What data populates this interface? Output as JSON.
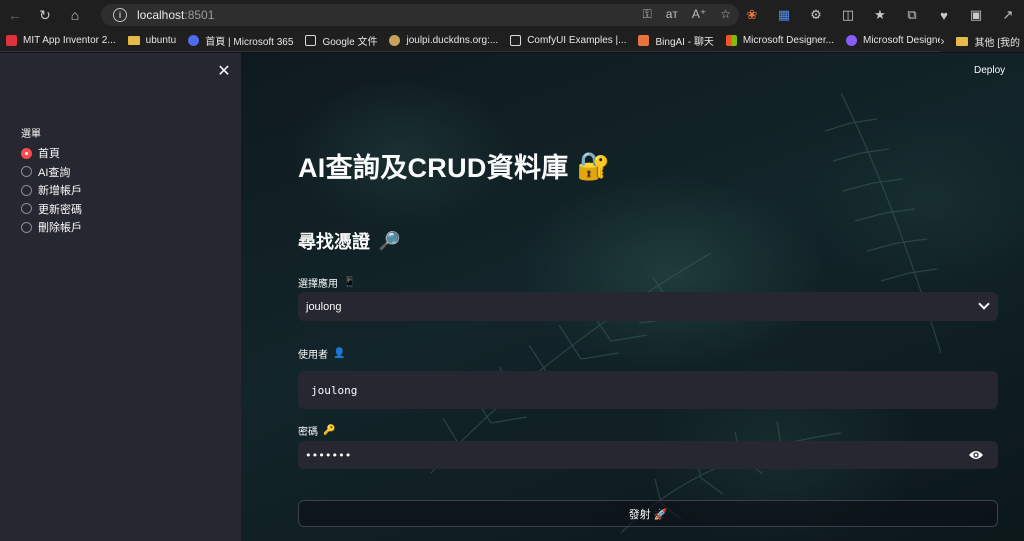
{
  "browser": {
    "url_host": "localhost",
    "url_port": ":8501",
    "bookmarks": [
      {
        "label": "MIT App Inventor 2...",
        "color": "#e0323c"
      },
      {
        "label": "ubuntu",
        "color": "#e8b94a"
      },
      {
        "label": "首頁 | Microsoft 365",
        "color": "#4f6bed"
      },
      {
        "label": "Google 文件",
        "color": "#d9d9d9"
      },
      {
        "label": "joulpi.duckdns.org:...",
        "color": "#c9a25a"
      },
      {
        "label": "ComfyUI Examples |...",
        "color": "#d9d9d9"
      },
      {
        "label": "BingAI - 聊天",
        "color": "#e8743b"
      },
      {
        "label": "Microsoft Designer...",
        "color": "#f35325"
      },
      {
        "label": "Microsoft Designer...",
        "color": "#8a5cf6"
      }
    ],
    "bookmarks_more": "其他 [我的"
  },
  "sidebar": {
    "menu_title": "選單",
    "items": [
      {
        "label": "首頁",
        "selected": true
      },
      {
        "label": "AI查詢",
        "selected": false
      },
      {
        "label": "新增帳戶",
        "selected": false
      },
      {
        "label": "更新密碼",
        "selected": false
      },
      {
        "label": "刪除帳戶",
        "selected": false
      }
    ]
  },
  "header": {
    "deploy_label": "Deploy"
  },
  "main": {
    "title": "AI查詢及CRUD資料庫",
    "title_emoji": "🔐",
    "subtitle": "尋找憑證",
    "subtitle_emoji": "🔎",
    "app_select": {
      "label": "選擇應用",
      "label_emoji": "📱",
      "value": "joulong"
    },
    "user_field": {
      "label": "使用者",
      "label_emoji": "👤",
      "value": "joulong"
    },
    "password_field": {
      "label": "密碼",
      "label_emoji": "🔑",
      "value": "•••••••"
    },
    "submit_label": "發射 🚀"
  },
  "colors": {
    "accent": "#ff4b4b",
    "sidebar_bg": "#262730",
    "input_bg": "#262730",
    "text": "#fafafa"
  }
}
